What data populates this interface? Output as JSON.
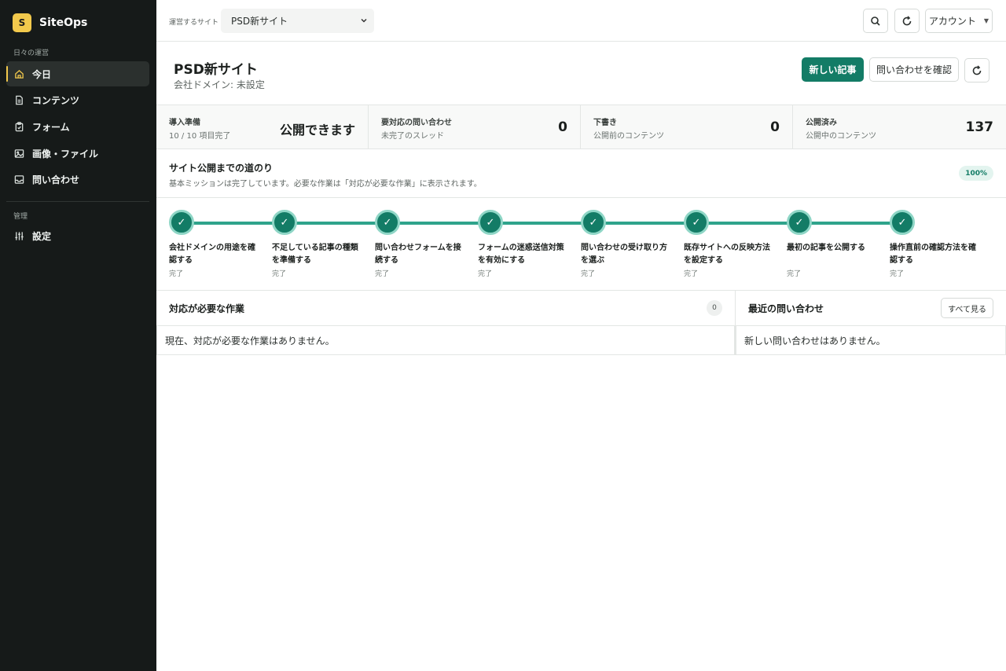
{
  "app": {
    "logo_letter": "S",
    "name": "SiteOps"
  },
  "sidebar": {
    "section_daily": "日々の運営",
    "section_admin": "管理",
    "items": [
      {
        "label": "今日",
        "icon": "home-icon",
        "active": true
      },
      {
        "label": "コンテンツ",
        "icon": "document-icon"
      },
      {
        "label": "フォーム",
        "icon": "clipboard-icon"
      },
      {
        "label": "画像・ファイル",
        "icon": "image-icon"
      },
      {
        "label": "問い合わせ",
        "icon": "inbox-icon"
      },
      {
        "label": "設定",
        "icon": "sliders-icon"
      }
    ]
  },
  "topbar": {
    "site_label": "運営するサイト",
    "site_selected": "PSD新サイト",
    "account_label": "アカウント"
  },
  "header": {
    "title": "PSD新サイト",
    "subtitle": "会社ドメイン: 未設定",
    "new_article": "新しい記事",
    "check_inquiries": "問い合わせを確認"
  },
  "stats": [
    {
      "title": "導入準備",
      "sub": "10 / 10 項目完了",
      "value": "公開できます"
    },
    {
      "title": "要対応の問い合わせ",
      "sub": "未完了のスレッド",
      "value": "0"
    },
    {
      "title": "下書き",
      "sub": "公開前のコンテンツ",
      "value": "0"
    },
    {
      "title": "公開済み",
      "sub": "公開中のコンテンツ",
      "value": "137"
    }
  ],
  "journey": {
    "title": "サイト公開までの道のり",
    "subtitle": "基本ミッションは完了しています。必要な作業は「対応が必要な作業」に表示されます。",
    "badge": "100%",
    "steps": [
      {
        "label": "会社ドメインの用途を確認する",
        "status": "完了"
      },
      {
        "label": "不足している記事の種類を準備する",
        "status": "完了"
      },
      {
        "label": "問い合わせフォームを接続する",
        "status": "完了"
      },
      {
        "label": "フォームの迷惑送信対策を有効にする",
        "status": "完了"
      },
      {
        "label": "問い合わせの受け取り方を選ぶ",
        "status": "完了"
      },
      {
        "label": "既存サイトへの反映方法を設定する",
        "status": "完了"
      },
      {
        "label": "最初の記事を公開する",
        "status": "完了"
      },
      {
        "label": "操作直前の確認方法を確認する",
        "status": "完了"
      }
    ]
  },
  "tasks": {
    "title": "対応が必要な作業",
    "count": "0",
    "empty": "現在、対応が必要な作業はありません。"
  },
  "inquiries": {
    "title": "最近の問い合わせ",
    "view_all": "すべて見る",
    "empty": "新しい問い合わせはありません。"
  },
  "colors": {
    "accent": "#137c66",
    "brand": "#f2c94c",
    "sidebar_bg": "#161a19"
  }
}
